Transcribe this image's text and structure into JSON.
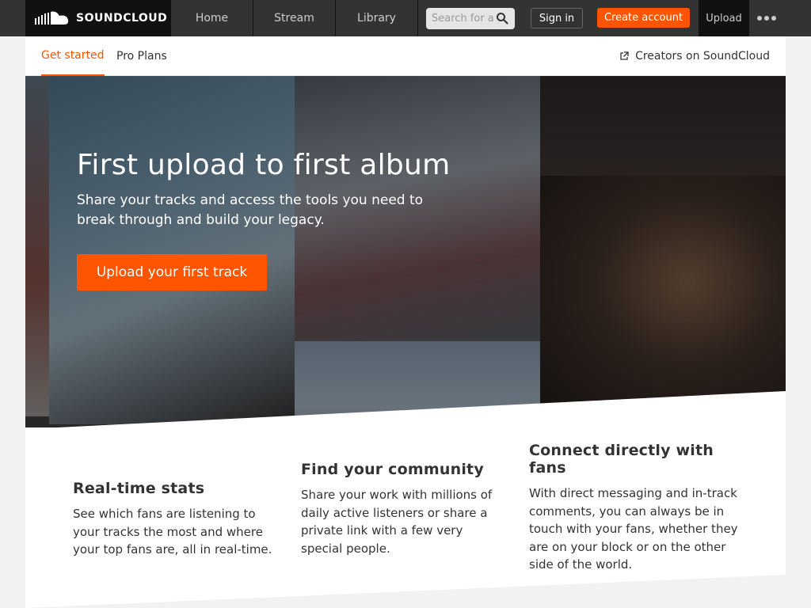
{
  "header": {
    "logo_text": "SOUNDCLOUD",
    "nav": {
      "home": "Home",
      "stream": "Stream",
      "library": "Library"
    },
    "search": {
      "placeholder": "Search for artists, bands, tracks, podcasts"
    },
    "sign_in": "Sign in",
    "create_account": "Create account",
    "upload": "Upload",
    "more_icon": "more-dots-icon"
  },
  "subnav": {
    "tabs": [
      "Get started",
      "Pro Plans"
    ],
    "active_tab": "Get started",
    "creators_link": "Creators on SoundCloud"
  },
  "hero": {
    "title": "First upload to first album",
    "subtitle": "Share your tracks and access the tools you need to break through and build your legacy.",
    "cta": "Upload your first track"
  },
  "features": [
    {
      "title": "Real-time stats",
      "description": "See which fans are listening to your tracks the most and where your top fans are, all in real-time."
    },
    {
      "title": "Find your community",
      "description": "Share your work with millions of daily active listeners or share a private link with a few very special people."
    },
    {
      "title": "Connect directly with fans",
      "description": "With direct messaging and in-track comments, you can always be in touch with your fans, whether they are on your block or on the other side of the world."
    }
  ],
  "colors": {
    "accent": "#ff5500",
    "header_bg": "#333333",
    "logo_bg": "#111111"
  }
}
